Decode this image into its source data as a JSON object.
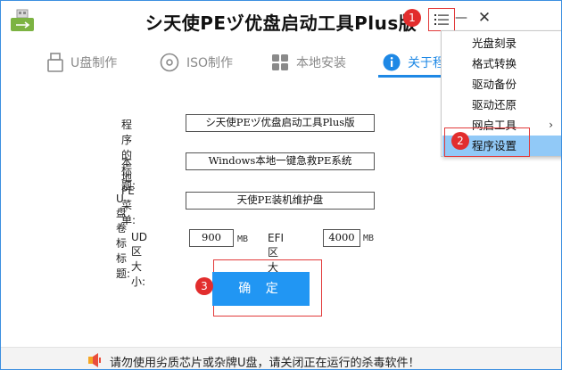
{
  "window": {
    "title": "シ天使PEヅ优盘启动工具Plus版",
    "menu_icon": "list-menu-icon",
    "minimize_label": "—",
    "close_label": "✕"
  },
  "tabs": [
    {
      "label": "U盘制作",
      "icon": "usb-drive-icon",
      "active": false
    },
    {
      "label": "ISO制作",
      "icon": "disc-icon",
      "active": false
    },
    {
      "label": "本地安装",
      "icon": "windows-grid-icon",
      "active": false
    },
    {
      "label": "关于程",
      "icon": "info-icon",
      "active": true
    }
  ],
  "form": {
    "program_title_label": "程序的标题:",
    "program_title_value": "シ天使PEヅ优盘启动工具Plus版",
    "local_pe_menu_label": "本地PE菜单:",
    "local_pe_menu_value": "Windows本地一键急救PE系统",
    "usb_volume_label": "U盘卷标标题:",
    "usb_volume_value": "天使PE装机维护盘",
    "ud_size_label": "UD区大小:",
    "ud_size_value": "900",
    "ud_size_unit": "MB",
    "efi_size_label": "EFI区大小:",
    "efi_size_value": "4000",
    "efi_size_unit": "MB",
    "confirm_label": "确 定"
  },
  "context_menu": {
    "items": [
      {
        "label": "光盘刻录",
        "submenu": false,
        "selected": false
      },
      {
        "label": "格式转换",
        "submenu": false,
        "selected": false
      },
      {
        "label": "驱动备份",
        "submenu": false,
        "selected": false
      },
      {
        "label": "驱动还原",
        "submenu": false,
        "selected": false
      },
      {
        "label": "网启工具",
        "submenu": true,
        "selected": false
      },
      {
        "label": "程序设置",
        "submenu": false,
        "selected": true
      }
    ],
    "submenu_arrow": "›"
  },
  "annotations": {
    "badge_1": "1",
    "badge_2": "2",
    "badge_3": "3"
  },
  "status": {
    "text": "请勿使用劣质芯片或杂牌U盘，请关闭正在运行的杀毒软件！",
    "icon": "speaker-icon"
  },
  "colors": {
    "accent": "#1e88e5",
    "button": "#2196f3",
    "menu_selected": "#91c9f7",
    "annotation_red": "#e22d2d",
    "border": "#3c8fe0"
  }
}
